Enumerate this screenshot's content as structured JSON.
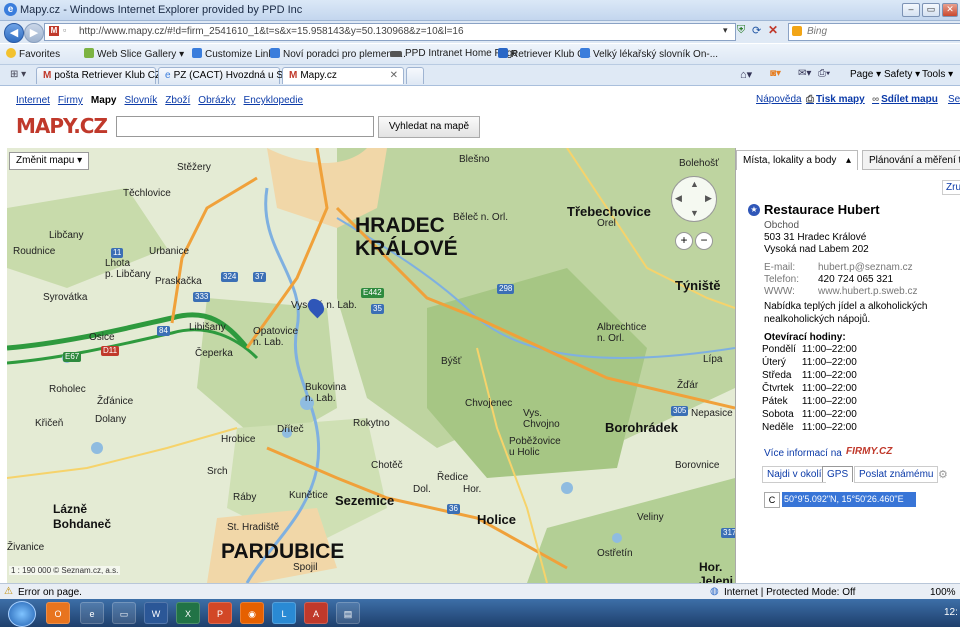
{
  "window": {
    "title": "Mapy.cz - Windows Internet Explorer provided by PPD Inc"
  },
  "navbar": {
    "address": "http://www.mapy.cz/#!d=firm_2541610_1&t=s&x=15.958143&y=50.130968&z=10&l=16",
    "search_placeholder": "Bing"
  },
  "favorites": {
    "label": "Favorites",
    "items": [
      "Web Slice Gallery ▾",
      "Customize Links",
      "Noví poradci pro plemena...",
      "PPD Intranet Home Page",
      "Retriever Klub CZ",
      "Velký lékařský slovník On-..."
    ]
  },
  "tabs": [
    {
      "label": "pošta Retriever Klub CZ - ..."
    },
    {
      "label": "PZ (CACT) Hvozdná u Sluš..."
    },
    {
      "label": "Mapy.cz"
    }
  ],
  "ie_commands": {
    "page": "Page ▾",
    "safety": "Safety ▾",
    "tools": "Tools ▾"
  },
  "site": {
    "nav": [
      "Internet",
      "Firmy",
      "Mapy",
      "Slovník",
      "Zboží",
      "Obrázky",
      "Encyklopedie"
    ],
    "nav_active": "Mapy",
    "help": "Nápověda",
    "print": "Tisk mapy",
    "share": "Sdílet mapu",
    "share_more": "Se",
    "logo": "MAPY.CZ",
    "search_button": "Vyhledat na mapě",
    "change_map": "Změnit mapu ▾"
  },
  "map": {
    "bigcities": [
      {
        "name": "HRADEC\nKRÁLOVÉ"
      },
      {
        "name": "PARDUBICE"
      }
    ],
    "cities": [
      "Třebechovice",
      "Týniště",
      "Borohrádek",
      "Sezemice",
      "Holice",
      "Lázně\nBohdaneč",
      "Hor.\nJeleni"
    ],
    "places": [
      "Stěžery",
      "Těchlovice",
      "Libčany",
      "Roudnice",
      "Urbanice",
      "Lhota\np. Libčany",
      "Syrovátka",
      "Praskačka",
      "Libišany",
      "Osice",
      "Čeperka",
      "Opatovice\nn. Lab.",
      "Vysoká n. Lab.",
      "Roholec",
      "Žďánice",
      "Dolany",
      "Křičeň",
      "Bukovina\nn. Lab.",
      "Hrobice",
      "Dříteč",
      "Rokytno",
      "Srch",
      "Chotěč",
      "Ráby",
      "Kunětice",
      "Dol.",
      "St. Hradiště",
      "Spojil",
      "Živanice",
      "Blešno",
      "Bolehošť",
      "Běleč n. Orl.",
      "Orel",
      "Albrechtice\nn. Orl.",
      "Býšť",
      "Chvojenec",
      "Vys.\nChvojno",
      "Poběžovice\nu Holic",
      "Ředice",
      "Hor.",
      "Veliny",
      "Ostřetín",
      "Lípa",
      "Žďár",
      "Borovnice",
      "Nepasice"
    ],
    "roads": [
      "E67",
      "D11",
      "11",
      "324",
      "37",
      "333",
      "35",
      "E442",
      "298",
      "84",
      "305",
      "36",
      "317"
    ],
    "scale": "1 : 190 000 © Seznam.cz, a.s."
  },
  "panel": {
    "tab1": "Místa, lokality a body",
    "tab2": "Plánování a měření tras",
    "close": "Zruš",
    "name": "Restaurace Hubert",
    "category": "Obchod",
    "address1": "503 31 Hradec Králové",
    "address2": "Vysoká nad Labem 202",
    "email_label": "E-mail:",
    "email": "hubert.p@seznam.cz",
    "phone_label": "Telefon:",
    "phone": "420 724 065 321",
    "www_label": "WWW:",
    "www": "www.hubert.p.sweb.cz",
    "description": "Nabídka teplých jídel a alkoholických nealkoholických nápojů.",
    "hours_title": "Otevírací hodiny:",
    "hours": [
      {
        "day": "Pondělí",
        "time": "11:00–22:00"
      },
      {
        "day": "Úterý",
        "time": "11:00–22:00"
      },
      {
        "day": "Středa",
        "time": "11:00–22:00"
      },
      {
        "day": "Čtvrtek",
        "time": "11:00–22:00"
      },
      {
        "day": "Pátek",
        "time": "11:00–22:00"
      },
      {
        "day": "Sobota",
        "time": "11:00–22:00"
      },
      {
        "day": "Neděle",
        "time": "11:00–22:00"
      }
    ],
    "more": "Více informací na",
    "firmy_logo": "FIRMY.CZ",
    "buttons": [
      "Najdi v okolí",
      "GPS",
      "Poslat známému"
    ],
    "gps_value": "50°9'5.092\"N, 15°50'26.460\"E"
  },
  "status": {
    "text": "Error on page.",
    "zone": "Internet | Protected Mode: Off",
    "zoom": "100%"
  },
  "taskbar": {
    "clock": "12:"
  }
}
